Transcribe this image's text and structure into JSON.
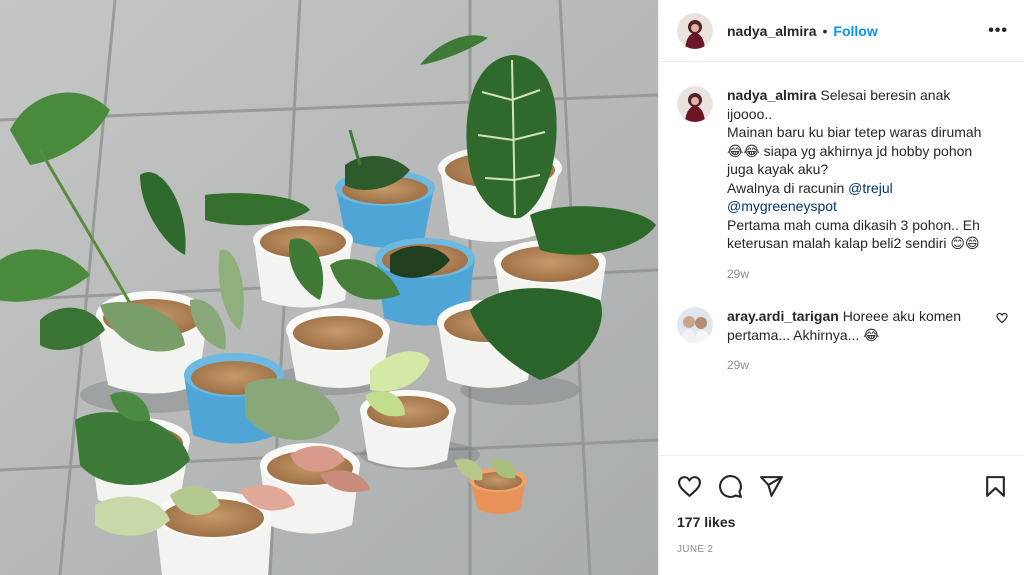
{
  "post": {
    "username": "nadya_almira",
    "dot": "•",
    "follow_label": "Follow",
    "more_label": "•••"
  },
  "caption": {
    "username": "nadya_almira",
    "line1": "Selesai beresin anak ijoooo..",
    "line2": "Mainan baru ku biar tetep waras dirumah 😂😂 siapa yg akhirnya jd hobby pohon juga kayak aku?",
    "line3_prefix": "Awalnya di racunin ",
    "mention1": "@trejul",
    "mention2": "@mygreeneyspot",
    "line4": "Pertama mah cuma dikasih 3 pohon.. Eh keterusan malah kalap beli2 sendiri 😊😄",
    "time": "29w"
  },
  "comment": {
    "username": "aray.ardi_tarigan",
    "text": "Horeee aku komen pertama... Akhirnya... 😂",
    "time": "29w"
  },
  "footer": {
    "likes": "177 likes",
    "date": "JUNE 2"
  },
  "icons": {
    "like": "heart-icon",
    "comment": "comment-icon",
    "share": "share-icon",
    "save": "bookmark-icon",
    "comment_like": "heart-icon"
  },
  "colors": {
    "follow": "#0095f6",
    "mention": "#00376b",
    "muted": "#8e8e8e"
  }
}
